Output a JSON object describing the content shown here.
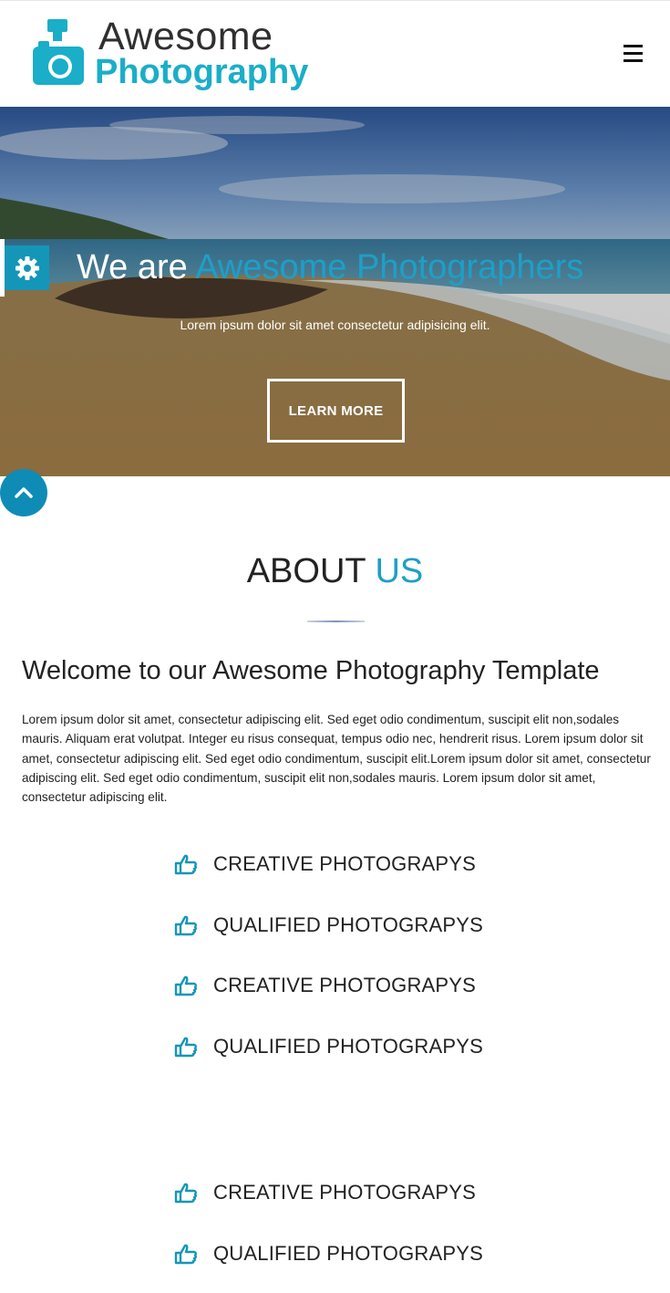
{
  "brand": {
    "line1": "Awesome",
    "line2": "Photography",
    "accent_color": "#1aaec9"
  },
  "header": {
    "menu_icon": "hamburger-icon"
  },
  "hero": {
    "title_plain": "We are ",
    "title_accent": "Awesome Photographers",
    "subtitle": "Lorem ipsum dolor sit amet consectetur adipisicing elit.",
    "button_label": "LEARN MORE",
    "settings_icon": "gear-icon"
  },
  "scroll_top_icon": "chevron-up-icon",
  "about": {
    "title_plain": "ABOUT ",
    "title_accent": "US",
    "welcome": "Welcome to our Awesome Photography Template",
    "paragraph": "Lorem ipsum dolor sit amet, consectetur adipiscing elit. Sed eget odio condimentum, suscipit elit non,sodales mauris. Aliquam erat volutpat. Integer eu risus consequat, tempus odio nec, hendrerit risus. Lorem ipsum dolor sit amet, consectetur adipiscing elit. Sed eget odio condimentum, suscipit elit.Lorem ipsum dolor sit amet, consectetur adipiscing elit. Sed eget odio condimentum, suscipit elit non,sodales mauris. Lorem ipsum dolor sit amet, consectetur adipiscing elit.",
    "features": [
      {
        "icon": "thumbs-up-icon",
        "label": "CREATIVE PHOTOGRAPYS"
      },
      {
        "icon": "thumbs-up-icon",
        "label": "QUALIFIED PHOTOGRAPYS"
      },
      {
        "icon": "thumbs-up-icon",
        "label": "CREATIVE PHOTOGRAPYS"
      },
      {
        "icon": "thumbs-up-icon",
        "label": "QUALIFIED PHOTOGRAPYS"
      },
      {
        "icon": "thumbs-up-icon",
        "label": "CREATIVE PHOTOGRAPYS"
      },
      {
        "icon": "thumbs-up-icon",
        "label": "QUALIFIED PHOTOGRAPYS"
      }
    ]
  },
  "colors": {
    "accent": "#1e9fc7",
    "button_blue": "#0e8cb6",
    "text": "#222222"
  }
}
